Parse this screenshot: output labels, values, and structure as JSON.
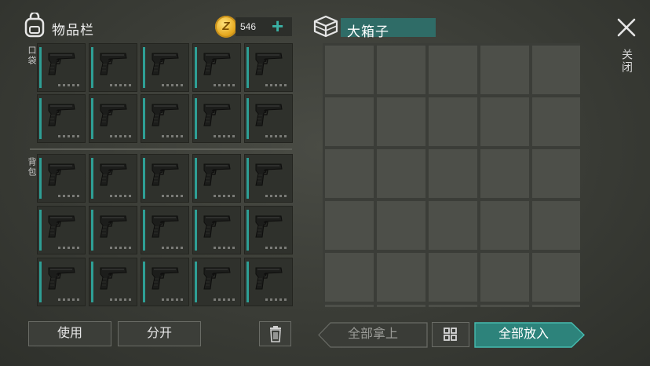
{
  "inventory": {
    "title": "物品栏",
    "coins": "546",
    "add_icon": "plus-icon",
    "bag_icon": "backpack-icon"
  },
  "sections": {
    "pocket_label": "口袋",
    "backpack_label": "背包"
  },
  "item": {
    "icon": "pistol-icon",
    "count_pockets": 10,
    "count_backpack": 15
  },
  "container": {
    "title": "大箱子",
    "icon": "box-icon"
  },
  "close": {
    "icon": "close-icon",
    "label": "关闭"
  },
  "buttons": {
    "use": "使用",
    "split": "分开",
    "trash_icon": "trash-icon",
    "take_all": "全部拿上",
    "arrange_icon": "grid-icon",
    "put_all": "全部放入"
  },
  "colors": {
    "accent": "#2e9f95",
    "panel_title_bg": "#2f6c67",
    "primary_button": "#2d837b"
  }
}
